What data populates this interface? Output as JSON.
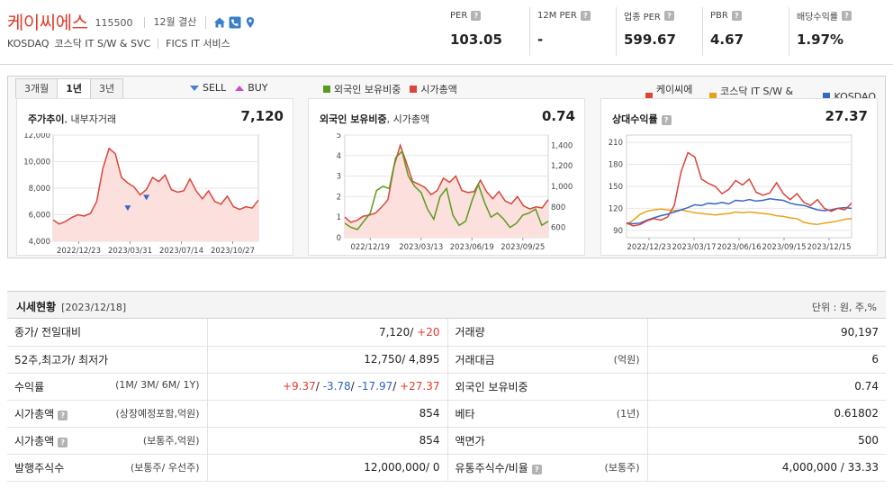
{
  "header": {
    "name": "케이씨에스",
    "code": "115500",
    "settle": "12월 결산",
    "market": "KOSDAQ",
    "industry": "코스닥 IT S/W & SVC",
    "fics": "FICS IT 서비스",
    "metrics": [
      {
        "label": "PER",
        "value": "103.05"
      },
      {
        "label": "12M PER",
        "value": "-"
      },
      {
        "label": "업종 PER",
        "value": "599.67"
      },
      {
        "label": "PBR",
        "value": "4.67"
      },
      {
        "label": "배당수익률",
        "value": "1.97%"
      }
    ]
  },
  "tabs": [
    "3개월",
    "1년",
    "3년"
  ],
  "legends": {
    "sell": "SELL",
    "buy": "BUY",
    "foreign": "외국인 보유비중",
    "mcap": "시가총액",
    "company": "케이씨에스",
    "sector": "코스닥 IT S/W & SVC",
    "kosdaq": "KOSDAQ"
  },
  "colors": {
    "red": "#d9463a",
    "green": "#5a9b1e",
    "orange": "#e8a21a",
    "blue": "#3467c6"
  },
  "cards": {
    "price": {
      "title_bold": "주가추이",
      "title_rest": ", 내부자거래",
      "value": "7,120"
    },
    "foreign": {
      "title_bold": "외국인 보유비중",
      "title_rest": ", 시가총액",
      "value": "0.74"
    },
    "relative": {
      "title_bold": "상대수익률",
      "value": "27.37"
    }
  },
  "chart_data": [
    {
      "type": "area",
      "title": "주가추이, 내부자거래",
      "x_ticks": [
        "2022/12/23",
        "2023/03/31",
        "2023/07/14",
        "2023/10/27"
      ],
      "y_ticks": [
        "4,000",
        "6,000",
        "8,000",
        "10,000",
        "12,000"
      ],
      "ylim": [
        4000,
        12000
      ],
      "values": [
        5600,
        5300,
        5500,
        5800,
        6000,
        5900,
        6100,
        7000,
        9500,
        11000,
        10600,
        8800,
        8400,
        8100,
        7500,
        7900,
        8800,
        8500,
        9000,
        7900,
        7700,
        7800,
        8700,
        7800,
        7200,
        7800,
        7000,
        6800,
        7400,
        6600,
        6400,
        6600,
        6500,
        7100
      ],
      "insider": [
        {
          "type": "SELL",
          "index": 12,
          "value": 6500
        },
        {
          "type": "SELL",
          "index": 15,
          "value": 7300
        }
      ]
    },
    {
      "type": "line",
      "title": "외국인 보유비중, 시가총액",
      "x_ticks": [
        "022/12/19",
        "2023/03/13",
        "2023/06/19",
        "2023/09/25"
      ],
      "y_left_ticks": [
        "0",
        "1",
        "2",
        "3",
        "4",
        "5"
      ],
      "y_right_ticks": [
        "600",
        "800",
        "1,000",
        "1,200",
        "1,400"
      ],
      "series": [
        {
          "name": "외국인 보유비중",
          "values": [
            0.7,
            0.5,
            0.4,
            0.8,
            1.2,
            2.3,
            2.5,
            2.4,
            3.9,
            4.2,
            3.0,
            2.5,
            2.2,
            1.4,
            0.9,
            2.0,
            2.4,
            1.1,
            0.6,
            0.8,
            1.8,
            2.6,
            1.7,
            1.0,
            1.2,
            0.9,
            0.5,
            0.7,
            1.1,
            1.2,
            1.4,
            0.6,
            0.8
          ]
        },
        {
          "name": "시가총액",
          "values": [
            700,
            650,
            670,
            710,
            720,
            740,
            800,
            870,
            1200,
            1400,
            1230,
            1050,
            1020,
            990,
            920,
            960,
            1080,
            1040,
            1100,
            960,
            940,
            950,
            1060,
            950,
            880,
            950,
            860,
            830,
            900,
            810,
            780,
            800,
            790,
            870
          ]
        }
      ]
    },
    {
      "type": "line",
      "title": "상대수익률",
      "x_ticks": [
        "2022/12/23",
        "2023/03/17",
        "2023/06/16",
        "2023/09/15",
        "2023/12/15"
      ],
      "y_ticks": [
        "90",
        "120",
        "150",
        "180",
        "210"
      ],
      "ylim": [
        90,
        210
      ],
      "series": [
        {
          "name": "케이씨에스",
          "values": [
            100,
            96,
            98,
            103,
            106,
            104,
            108,
            124,
            170,
            196,
            190,
            160,
            154,
            150,
            140,
            146,
            158,
            152,
            160,
            142,
            138,
            141,
            155,
            140,
            132,
            140,
            128,
            124,
            132,
            120,
            116,
            120,
            118,
            127
          ]
        },
        {
          "name": "코스닥 IT S/W & SVC",
          "values": [
            98,
            104,
            112,
            116,
            118,
            119,
            118,
            117,
            118,
            116,
            114,
            113,
            112,
            111,
            112,
            113,
            115,
            114,
            115,
            114,
            113,
            112,
            110,
            109,
            107,
            106,
            101,
            99,
            98,
            100,
            101,
            103,
            105,
            106
          ]
        },
        {
          "name": "KOSDAQ",
          "values": [
            100,
            99,
            100,
            104,
            107,
            110,
            112,
            115,
            118,
            121,
            125,
            124,
            127,
            126,
            128,
            126,
            131,
            130,
            132,
            130,
            131,
            133,
            132,
            131,
            127,
            125,
            124,
            121,
            118,
            117,
            118,
            120,
            121,
            120
          ]
        }
      ]
    }
  ],
  "table": {
    "title": "시세현황",
    "date": "[2023/12/18]",
    "unit": "단위 : 원, 주,%",
    "rows": [
      {
        "l1": "종가/ 전일대비",
        "u1": "",
        "v1a": "7,120/ ",
        "v1b": "+20",
        "l2": "거래량",
        "u2": "",
        "v2": "90,197"
      },
      {
        "l1": "52주,최고가/ 최저가",
        "u1": "",
        "v1a": "12,750/ 4,895",
        "v1b": "",
        "l2": "거래대금",
        "u2": "(억원)",
        "v2": "6"
      },
      {
        "l1": "수익률",
        "u1": "(1M/ 3M/ 6M/ 1Y)",
        "r1": "+9.37",
        "r2": "-3.78",
        "r3": "-17.97",
        "r4": "+27.37",
        "l2": "외국인 보유비중",
        "u2": "",
        "v2": "0.74"
      },
      {
        "l1": "시가총액",
        "u1": "(상장예정포함,억원)",
        "v1a": "854",
        "v1b": "",
        "l2": "베타",
        "u2": "(1년)",
        "v2": "0.61802"
      },
      {
        "l1": "시가총액",
        "u1": "(보통주,억원)",
        "v1a": "854",
        "v1b": "",
        "l2": "액면가",
        "u2": "",
        "v2": "500"
      },
      {
        "l1": "발행주식수",
        "u1": "(보통주/ 우선주)",
        "v1a": "12,000,000/ 0",
        "v1b": "",
        "l2": "유통주식수/비율",
        "u2": "(보통주)",
        "v2": "4,000,000 / 33.33"
      }
    ]
  }
}
